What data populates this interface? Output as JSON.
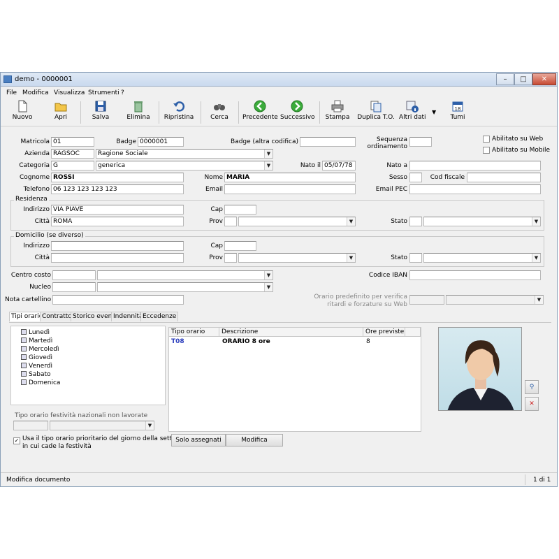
{
  "window": {
    "title": "demo - 0000001",
    "min": "–",
    "max": "□",
    "close": "✕"
  },
  "menu": [
    "File",
    "Modifica",
    "Visualizza",
    "Strumenti",
    "?"
  ],
  "toolbar": {
    "nuovo": "Nuovo",
    "apri": "Apri",
    "salva": "Salva",
    "elimina": "Elimina",
    "ripristina": "Ripristina",
    "cerca": "Cerca",
    "precedente": "Precedente",
    "successivo": "Successivo",
    "stampa": "Stampa",
    "duplica": "Duplica T.O.",
    "altri_dati": "Altri dati",
    "tumi": "Tumi",
    "tumi_badge": "18"
  },
  "form": {
    "matricola_label": "Matricola",
    "matricola": "01",
    "badge_label": "Badge",
    "badge": "0000001",
    "badge_alt_label": "Badge (altra codifica)",
    "badge_alt": "",
    "sequenza_label1": "Sequenza",
    "sequenza_label2": "ordinamento",
    "sequenza": "",
    "web_label": "Abilitato su Web",
    "mobile_label": "Abilitato su Mobile",
    "azienda_label": "Azienda",
    "azienda_code": "RAGSOC",
    "azienda_desc": "Ragione Sociale",
    "categoria_label": "Categoria",
    "categoria_code": "G",
    "categoria_desc": "generica",
    "nato_il_label": "Nato il",
    "nato_il": "05/07/78",
    "nato_a_label": "Nato a",
    "nato_a": "",
    "cognome_label": "Cognome",
    "cognome": "ROSSI",
    "nome_label": "Nome",
    "nome": "MARIA",
    "sesso_label": "Sesso",
    "sesso": "",
    "cf_label": "Cod fiscale",
    "cf": "",
    "telefono_label": "Telefono",
    "telefono": "06 123 123 123 123",
    "email_label": "Email",
    "email": "",
    "pec_label": "Email PEC",
    "pec": "",
    "residenza_title": "Residenza",
    "res_indirizzo_label": "Indirizzo",
    "res_indirizzo": "VIA PIAVE",
    "res_cap_label": "Cap",
    "res_cap": "",
    "res_citta_label": "Città",
    "res_citta": "ROMA",
    "res_prov_label": "Prov",
    "res_stato_label": "Stato",
    "domicilio_title": "Domicilio (se diverso)",
    "dom_indirizzo_label": "Indirizzo",
    "dom_cap_label": "Cap",
    "dom_citta_label": "Città",
    "dom_prov_label": "Prov",
    "dom_stato_label": "Stato",
    "centro_costo_label": "Centro costo",
    "codice_iban_label": "Codice IBAN",
    "nucleo_label": "Nucleo",
    "nota_label": "Nota cartellino",
    "orario_label1": "Orario predefinito per verifica",
    "orario_label2": "ritardi e forzature su Web"
  },
  "tabs": [
    "Tipi orario",
    "Contratto",
    "Storico eventi",
    "Indennità",
    "Eccedenze"
  ],
  "days": [
    "Lunedì",
    "Martedì",
    "Mercoledì",
    "Giovedì",
    "Venerdì",
    "Sabato",
    "Domenica"
  ],
  "festivita_label": "Tipo orario festività nazionali non lavorate",
  "use_prio_label1": "Usa il tipo orario prioritario del giorno della settimana",
  "use_prio_label2": "in cui cade la festività",
  "table": {
    "headers": [
      "Tipo orario",
      "Descrizione",
      "Ore previste"
    ],
    "rows": [
      {
        "code": "T08",
        "desc": "ORARIO 8 ore",
        "ore": "8"
      }
    ]
  },
  "buttons": {
    "solo_assegnati": "Solo assegnati",
    "modifica": "Modifica"
  },
  "status": {
    "left": "Modifica documento",
    "right": "1 di 1"
  }
}
